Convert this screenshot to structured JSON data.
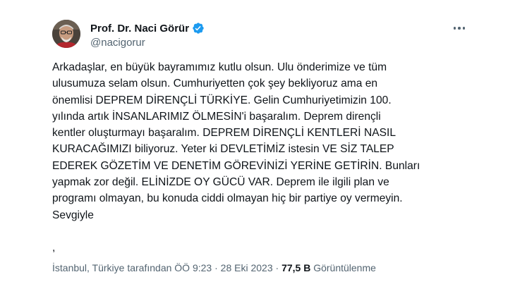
{
  "author": {
    "display_name": "Prof. Dr. Naci Görür",
    "handle": "@nacigorur",
    "verified_icon": "verified-badge-icon",
    "verified_color": "#1d9bf0"
  },
  "menu": {
    "icon": "more-options-icon"
  },
  "tweet": {
    "text": "Arkadaşlar, en büyük bayramımız kutlu olsun. Ulu önderimize ve tüm\nulusumuza selam olsun. Cumhuriyetten çok şey bekliyoruz ama en\nönemlisi DEPREM DİRENÇLİ TÜRKİYE. Gelin Cumhuriyetimizin 100.\nyılında artık İNSANLARIMIZ ÖLMESİN'i başaralım. Deprem dirençli\nkentler oluşturmayı başaralım. DEPREM DİRENÇLİ KENTLERİ NASIL\nKURACAĞIMIZI biliyoruz. Yeter ki DEVLETİMİZ istesin VE SİZ TALEP\nEDEREK GÖZETİM VE DENETİM GÖREVİNİZİ YERİNE GETİRİN.  Bunları\nyapmak zor değil. ELİNİZDE OY GÜCÜ VAR. Deprem ile ilgili plan ve\nprogramı olmayan, bu konuda ciddi olmayan hiç bir partiye oy vermeyin.\nSevgiyle\n\n,"
  },
  "meta": {
    "location_time": "İstanbul, Türkiye tarafından ÖÖ 9:23",
    "separator": " · ",
    "date": "28 Eki 2023",
    "separator2": " · ",
    "views_count": "77,5 B",
    "views_label": " Görüntülenme"
  },
  "colors": {
    "text": "#0f1419",
    "secondary": "#536471",
    "background": "#ffffff"
  }
}
